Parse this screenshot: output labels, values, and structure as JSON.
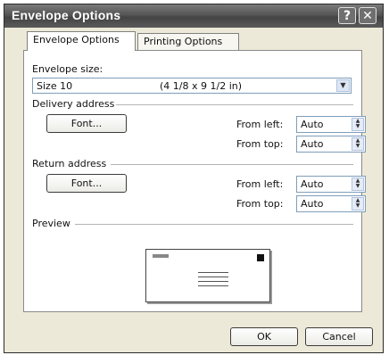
{
  "window": {
    "title": "Envelope Options"
  },
  "titlebar": {
    "help_glyph": "?",
    "close_glyph": "✕"
  },
  "tabs": [
    {
      "label": "Envelope Options",
      "active": true
    },
    {
      "label": "Printing Options",
      "active": false
    }
  ],
  "envelope_size": {
    "label": "Envelope size:",
    "selected_name": "Size 10",
    "selected_dims": "(4 1/8 x 9 1/2 in)"
  },
  "delivery": {
    "group_label": "Delivery address",
    "font_button": "Font...",
    "from_left_label": "From left:",
    "from_left_value": "Auto",
    "from_top_label": "From top:",
    "from_top_value": "Auto"
  },
  "return": {
    "group_label": "Return address",
    "font_button": "Font...",
    "from_left_label": "From left:",
    "from_left_value": "Auto",
    "from_top_label": "From top:",
    "from_top_value": "Auto"
  },
  "preview": {
    "group_label": "Preview"
  },
  "footer": {
    "ok_label": "OK",
    "cancel_label": "Cancel"
  }
}
